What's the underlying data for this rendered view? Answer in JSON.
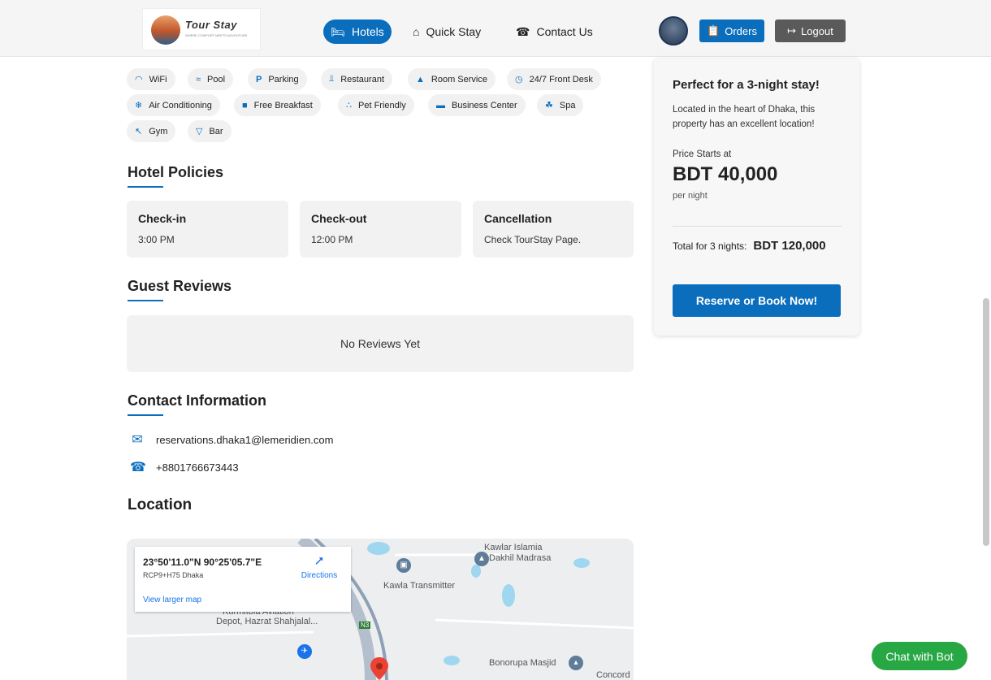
{
  "header": {
    "logo_title": "Tour Stay",
    "logo_tagline": "WHERE COMFORT MEETS ADVENTURE",
    "nav": [
      {
        "label": "Hotels",
        "icon": "bed-icon"
      },
      {
        "label": "Quick Stay",
        "icon": "house-icon"
      },
      {
        "label": "Contact Us",
        "icon": "phone-icon"
      }
    ],
    "orders_label": "Orders",
    "logout_label": "Logout"
  },
  "amenities": [
    {
      "label": "WiFi",
      "icon": "wifi-icon"
    },
    {
      "label": "Pool",
      "icon": "pool-icon"
    },
    {
      "label": "Parking",
      "icon": "parking-icon"
    },
    {
      "label": "Restaurant",
      "icon": "utensils-icon"
    },
    {
      "label": "Room Service",
      "icon": "bell-icon"
    },
    {
      "label": "24/7 Front Desk",
      "icon": "clock-icon"
    },
    {
      "label": "Air Conditioning",
      "icon": "snowflake-icon"
    },
    {
      "label": "Free Breakfast",
      "icon": "coffee-icon"
    },
    {
      "label": "Pet Friendly",
      "icon": "paw-icon"
    },
    {
      "label": "Business Center",
      "icon": "briefcase-icon"
    },
    {
      "label": "Spa",
      "icon": "spa-icon"
    },
    {
      "label": "Gym",
      "icon": "dumbbell-icon"
    },
    {
      "label": "Bar",
      "icon": "cocktail-icon"
    }
  ],
  "policies": {
    "title": "Hotel Policies",
    "items": [
      {
        "title": "Check-in",
        "value": "3:00 PM"
      },
      {
        "title": "Check-out",
        "value": "12:00 PM"
      },
      {
        "title": "Cancellation",
        "value": "Check TourStay Page."
      }
    ]
  },
  "reviews": {
    "title": "Guest Reviews",
    "empty_text": "No Reviews Yet"
  },
  "contact": {
    "title": "Contact Information",
    "email": "reservations.dhaka1@lemeridien.com",
    "phone": "+8801766673443"
  },
  "location": {
    "title": "Location",
    "coords": "23°50'11.0\"N 90°25'05.7\"E",
    "plus_code": "RCP9+H75 Dhaka",
    "directions_label": "Directions",
    "larger_map_label": "View larger map",
    "map_labels": [
      "Kawlar Islamia",
      "Dakhil Madrasa",
      "Kawla Transmitter",
      "Kurmitola Aviation",
      "Depot, Hazrat Shahjalal...",
      "Bonorupa Masjid",
      "Concord",
      "N3"
    ]
  },
  "booking": {
    "headline": "Perfect for a 3-night stay!",
    "description": "Located in the heart of Dhaka, this property has an excellent location!",
    "price_label": "Price Starts at",
    "price": "BDT 40,000",
    "per_night": "per night",
    "total_label": "Total for 3 nights:",
    "total_value": "BDT 120,000",
    "book_label": "Reserve or Book Now!"
  },
  "chat_label": "Chat with Bot",
  "colors": {
    "accent": "#0a6ebd",
    "chat": "#28a745",
    "logout": "#5a5a5a"
  }
}
